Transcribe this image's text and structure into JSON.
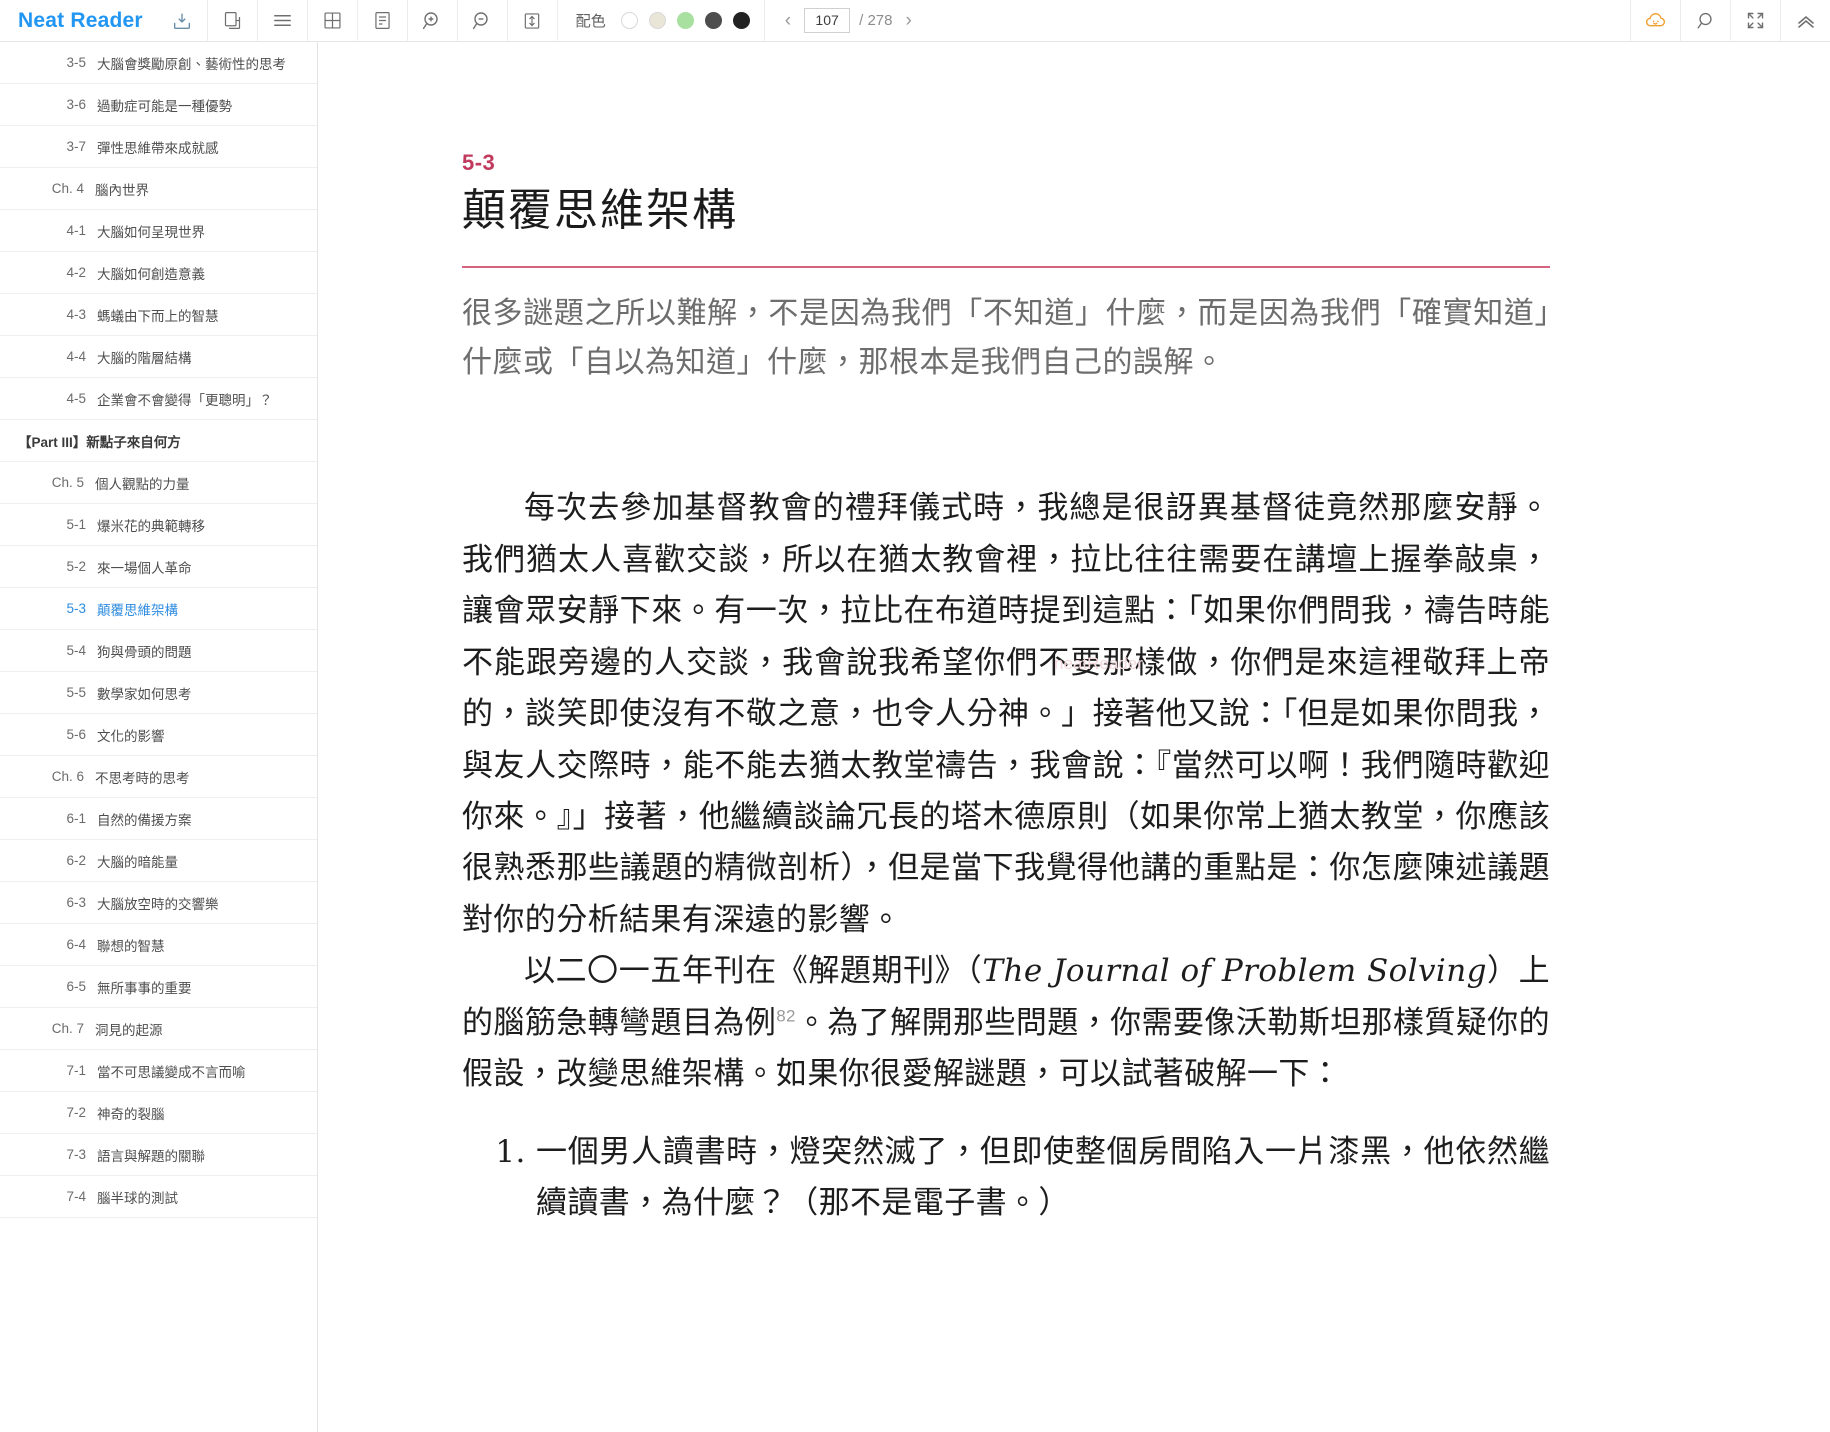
{
  "app": {
    "brand": "Neat Reader"
  },
  "toolbar": {
    "icons": [
      {
        "name": "download-icon",
        "title": "下載"
      },
      {
        "name": "copy-pages-icon",
        "title": "雙頁"
      },
      {
        "name": "menu-icon",
        "title": "目錄"
      },
      {
        "name": "grid-icon",
        "title": "網格"
      },
      {
        "name": "notes-icon",
        "title": "筆記"
      },
      {
        "name": "zoom-in-icon",
        "title": "放大"
      },
      {
        "name": "zoom-out-icon",
        "title": "縮小"
      },
      {
        "name": "line-height-icon",
        "title": "行距"
      }
    ],
    "theme": {
      "label": "配色",
      "swatches": [
        {
          "name": "theme-white",
          "color": "#ffffff",
          "selected": false
        },
        {
          "name": "theme-sepia",
          "color": "#eae6d7",
          "selected": false
        },
        {
          "name": "theme-green",
          "color": "#a8e0a0",
          "selected": false
        },
        {
          "name": "theme-gray",
          "color": "#4d4d4d",
          "selected": false
        },
        {
          "name": "theme-black",
          "color": "#222222",
          "selected": false
        }
      ]
    },
    "pager": {
      "prev": "‹",
      "next": "›",
      "current": "107",
      "total": "/ 278"
    },
    "right_icons": [
      {
        "name": "cloud-sync-icon",
        "title": "雲端",
        "color": "#f0a030"
      },
      {
        "name": "search-icon",
        "title": "搜尋"
      },
      {
        "name": "fullscreen-icon",
        "title": "全螢幕"
      },
      {
        "name": "collapse-up-icon",
        "title": "收起"
      }
    ]
  },
  "sidebar": {
    "items": [
      {
        "level": "section",
        "num": "3-5",
        "title": "大腦會獎勵原創、藝術性的思考",
        "active": false
      },
      {
        "level": "section",
        "num": "3-6",
        "title": "過動症可能是一種優勢",
        "active": false
      },
      {
        "level": "section",
        "num": "3-7",
        "title": "彈性思維帶來成就感",
        "active": false
      },
      {
        "level": "chapter",
        "num": "Ch. 4",
        "title": "腦內世界",
        "active": false
      },
      {
        "level": "section",
        "num": "4-1",
        "title": "大腦如何呈現世界",
        "active": false
      },
      {
        "level": "section",
        "num": "4-2",
        "title": "大腦如何創造意義",
        "active": false
      },
      {
        "level": "section",
        "num": "4-3",
        "title": "螞蟻由下而上的智慧",
        "active": false
      },
      {
        "level": "section",
        "num": "4-4",
        "title": "大腦的階層結構",
        "active": false
      },
      {
        "level": "section",
        "num": "4-5",
        "title": "企業會不會變得「更聰明」？",
        "active": false
      },
      {
        "level": "part",
        "num": "",
        "title": "【Part III】新點子來自何方",
        "active": false
      },
      {
        "level": "chapter",
        "num": "Ch. 5",
        "title": "個人觀點的力量",
        "active": false
      },
      {
        "level": "section",
        "num": "5-1",
        "title": "爆米花的典範轉移",
        "active": false
      },
      {
        "level": "section",
        "num": "5-2",
        "title": "來一場個人革命",
        "active": false
      },
      {
        "level": "section",
        "num": "5-3",
        "title": "顛覆思維架構",
        "active": true
      },
      {
        "level": "section",
        "num": "5-4",
        "title": "狗與骨頭的問題",
        "active": false
      },
      {
        "level": "section",
        "num": "5-5",
        "title": "數學家如何思考",
        "active": false
      },
      {
        "level": "section",
        "num": "5-6",
        "title": "文化的影響",
        "active": false
      },
      {
        "level": "chapter",
        "num": "Ch. 6",
        "title": "不思考時的思考",
        "active": false
      },
      {
        "level": "section",
        "num": "6-1",
        "title": "自然的備援方案",
        "active": false
      },
      {
        "level": "section",
        "num": "6-2",
        "title": "大腦的暗能量",
        "active": false
      },
      {
        "level": "section",
        "num": "6-3",
        "title": "大腦放空時的交響樂",
        "active": false
      },
      {
        "level": "section",
        "num": "6-4",
        "title": "聯想的智慧",
        "active": false
      },
      {
        "level": "section",
        "num": "6-5",
        "title": "無所事事的重要",
        "active": false
      },
      {
        "level": "chapter",
        "num": "Ch. 7",
        "title": "洞見的起源",
        "active": false
      },
      {
        "level": "section",
        "num": "7-1",
        "title": "當不可思議變成不言而喻",
        "active": false
      },
      {
        "level": "section",
        "num": "7-2",
        "title": "神奇的裂腦",
        "active": false
      },
      {
        "level": "section",
        "num": "7-3",
        "title": "語言與解題的關聯",
        "active": false
      },
      {
        "level": "section",
        "num": "7-4",
        "title": "腦半球的測試",
        "active": false
      }
    ]
  },
  "content": {
    "section_number": "5-3",
    "section_title": "顛覆思維架構",
    "epigraph": "很多謎題之所以難解，不是因為我們「不知道」什麼，而是因為我們「確實知道」什麼或「自以為知道」什麼，那根本是我們自己的誤解。",
    "paragraph_1": "每次去參加基督教會的禮拜儀式時，我總是很訝異基督徒竟然那麼安靜。我們猶太人喜歡交談，所以在猶太教會裡，拉比往往需要在講壇上握拳敲桌，讓會眾安靜下來。有一次，拉比在布道時提到這點：「如果你們問我，禱告時能不能跟旁邊的人交談，我會說我希望你們不要那樣做，你們是來這裡敬拜上帝的，談笑即使沒有不敬之意，也令人分神。」接著他又說：「但是如果你問我，與友人交際時，能不能去猶太教堂禱告，我會說：『當然可以啊！我們隨時歡迎你來。』」接著，他繼續談論冗長的塔木德原則（如果你常上猶太教堂，你應該很熟悉那些議題的精微剖析），但是當下我覺得他講的重點是：你怎麼陳述議題對你的分析結果有深遠的影響。",
    "paragraph_2_a": "以二〇一五年刊在《解題期刊》（",
    "paragraph_2_italic": "The Journal of Problem Solving",
    "paragraph_2_b": "）上的腦筋急轉彎題目為例",
    "footnote_ref": "82",
    "paragraph_2_c": "。為了解開那些問題，你需要像沃勒斯坦那樣質疑你的假設，改變思維架構。如果你很愛解謎題，可以試著破解一下：",
    "list_items": [
      "一個男人讀書時，燈突然滅了，但即使整個房間陷入一片漆黑，他依然繼續讀書，為什麼？（那不是電子書。）"
    ],
    "watermark": "neatReader"
  }
}
